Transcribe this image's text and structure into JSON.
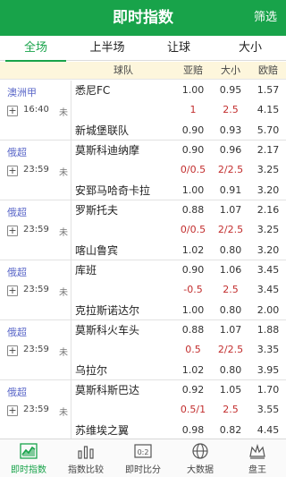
{
  "header": {
    "title": "即时指数",
    "filter_label": "筛选"
  },
  "tabs": [
    {
      "label": "全场",
      "active": true
    },
    {
      "label": "上半场",
      "active": false
    },
    {
      "label": "让球",
      "active": false
    },
    {
      "label": "大小",
      "active": false
    }
  ],
  "columns": {
    "team": "球队",
    "asia": "亚赔",
    "size": "大小",
    "euro": "欧赔"
  },
  "matches": [
    {
      "league": "澳洲甲",
      "time": "16:40",
      "status": "未",
      "rows": [
        {
          "team": "悉尼FC",
          "asia": "1.00",
          "size": "0.95",
          "euro": "1.57",
          "red": false
        },
        {
          "team": "",
          "asia": "1",
          "size": "2.5",
          "euro": "4.15",
          "red": true
        },
        {
          "team": "新城堡联队",
          "asia": "0.90",
          "size": "0.93",
          "euro": "5.70",
          "red": false
        }
      ]
    },
    {
      "league": "俄超",
      "time": "23:59",
      "status": "未",
      "rows": [
        {
          "team": "莫斯科迪纳摩",
          "asia": "0.90",
          "size": "0.96",
          "euro": "2.17",
          "red": false
        },
        {
          "team": "",
          "asia": "0/0.5",
          "size": "2/2.5",
          "euro": "3.25",
          "red": true
        },
        {
          "team": "安郅马哈奇卡拉",
          "asia": "1.00",
          "size": "0.91",
          "euro": "3.20",
          "red": false
        }
      ]
    },
    {
      "league": "俄超",
      "time": "23:59",
      "status": "未",
      "rows": [
        {
          "team": "罗斯托夫",
          "asia": "0.88",
          "size": "1.07",
          "euro": "2.16",
          "red": false
        },
        {
          "team": "",
          "asia": "0/0.5",
          "size": "2/2.5",
          "euro": "3.25",
          "red": true
        },
        {
          "team": "喀山鲁宾",
          "asia": "1.02",
          "size": "0.80",
          "euro": "3.20",
          "red": false
        }
      ]
    },
    {
      "league": "俄超",
      "time": "23:59",
      "status": "未",
      "rows": [
        {
          "team": "库班",
          "asia": "0.90",
          "size": "1.06",
          "euro": "3.45",
          "red": false
        },
        {
          "team": "",
          "asia": "-0.5",
          "size": "2.5",
          "euro": "3.45",
          "red": true
        },
        {
          "team": "克拉斯诺达尔",
          "asia": "1.00",
          "size": "0.80",
          "euro": "2.00",
          "red": false
        }
      ]
    },
    {
      "league": "俄超",
      "time": "23:59",
      "status": "未",
      "rows": [
        {
          "team": "莫斯科火车头",
          "asia": "0.88",
          "size": "1.07",
          "euro": "1.88",
          "red": false
        },
        {
          "team": "",
          "asia": "0.5",
          "size": "2/2.5",
          "euro": "3.35",
          "red": true
        },
        {
          "team": "乌拉尔",
          "asia": "1.02",
          "size": "0.80",
          "euro": "3.95",
          "red": false
        }
      ]
    },
    {
      "league": "俄超",
      "time": "23:59",
      "status": "未",
      "rows": [
        {
          "team": "莫斯科斯巴达",
          "asia": "0.92",
          "size": "1.05",
          "euro": "1.70",
          "red": false
        },
        {
          "team": "",
          "asia": "0.5/1",
          "size": "2.5",
          "euro": "3.55",
          "red": true
        },
        {
          "team": "苏维埃之翼",
          "asia": "0.98",
          "size": "0.82",
          "euro": "4.45",
          "red": false
        }
      ]
    }
  ],
  "bottom_nav": [
    {
      "label": "即时指数",
      "icon": "line-chart-icon",
      "active": true
    },
    {
      "label": "指数比较",
      "icon": "bar-chart-icon",
      "active": false
    },
    {
      "label": "即时比分",
      "icon": "scoreboard-icon",
      "active": false
    },
    {
      "label": "大数据",
      "icon": "globe-icon",
      "active": false
    },
    {
      "label": "盘王",
      "icon": "crown-icon",
      "active": false
    }
  ],
  "colors": {
    "primary": "#18a34a",
    "league": "#5a67c8",
    "handicap": "#c22d2d",
    "header_bg": "#fdf6dc"
  }
}
